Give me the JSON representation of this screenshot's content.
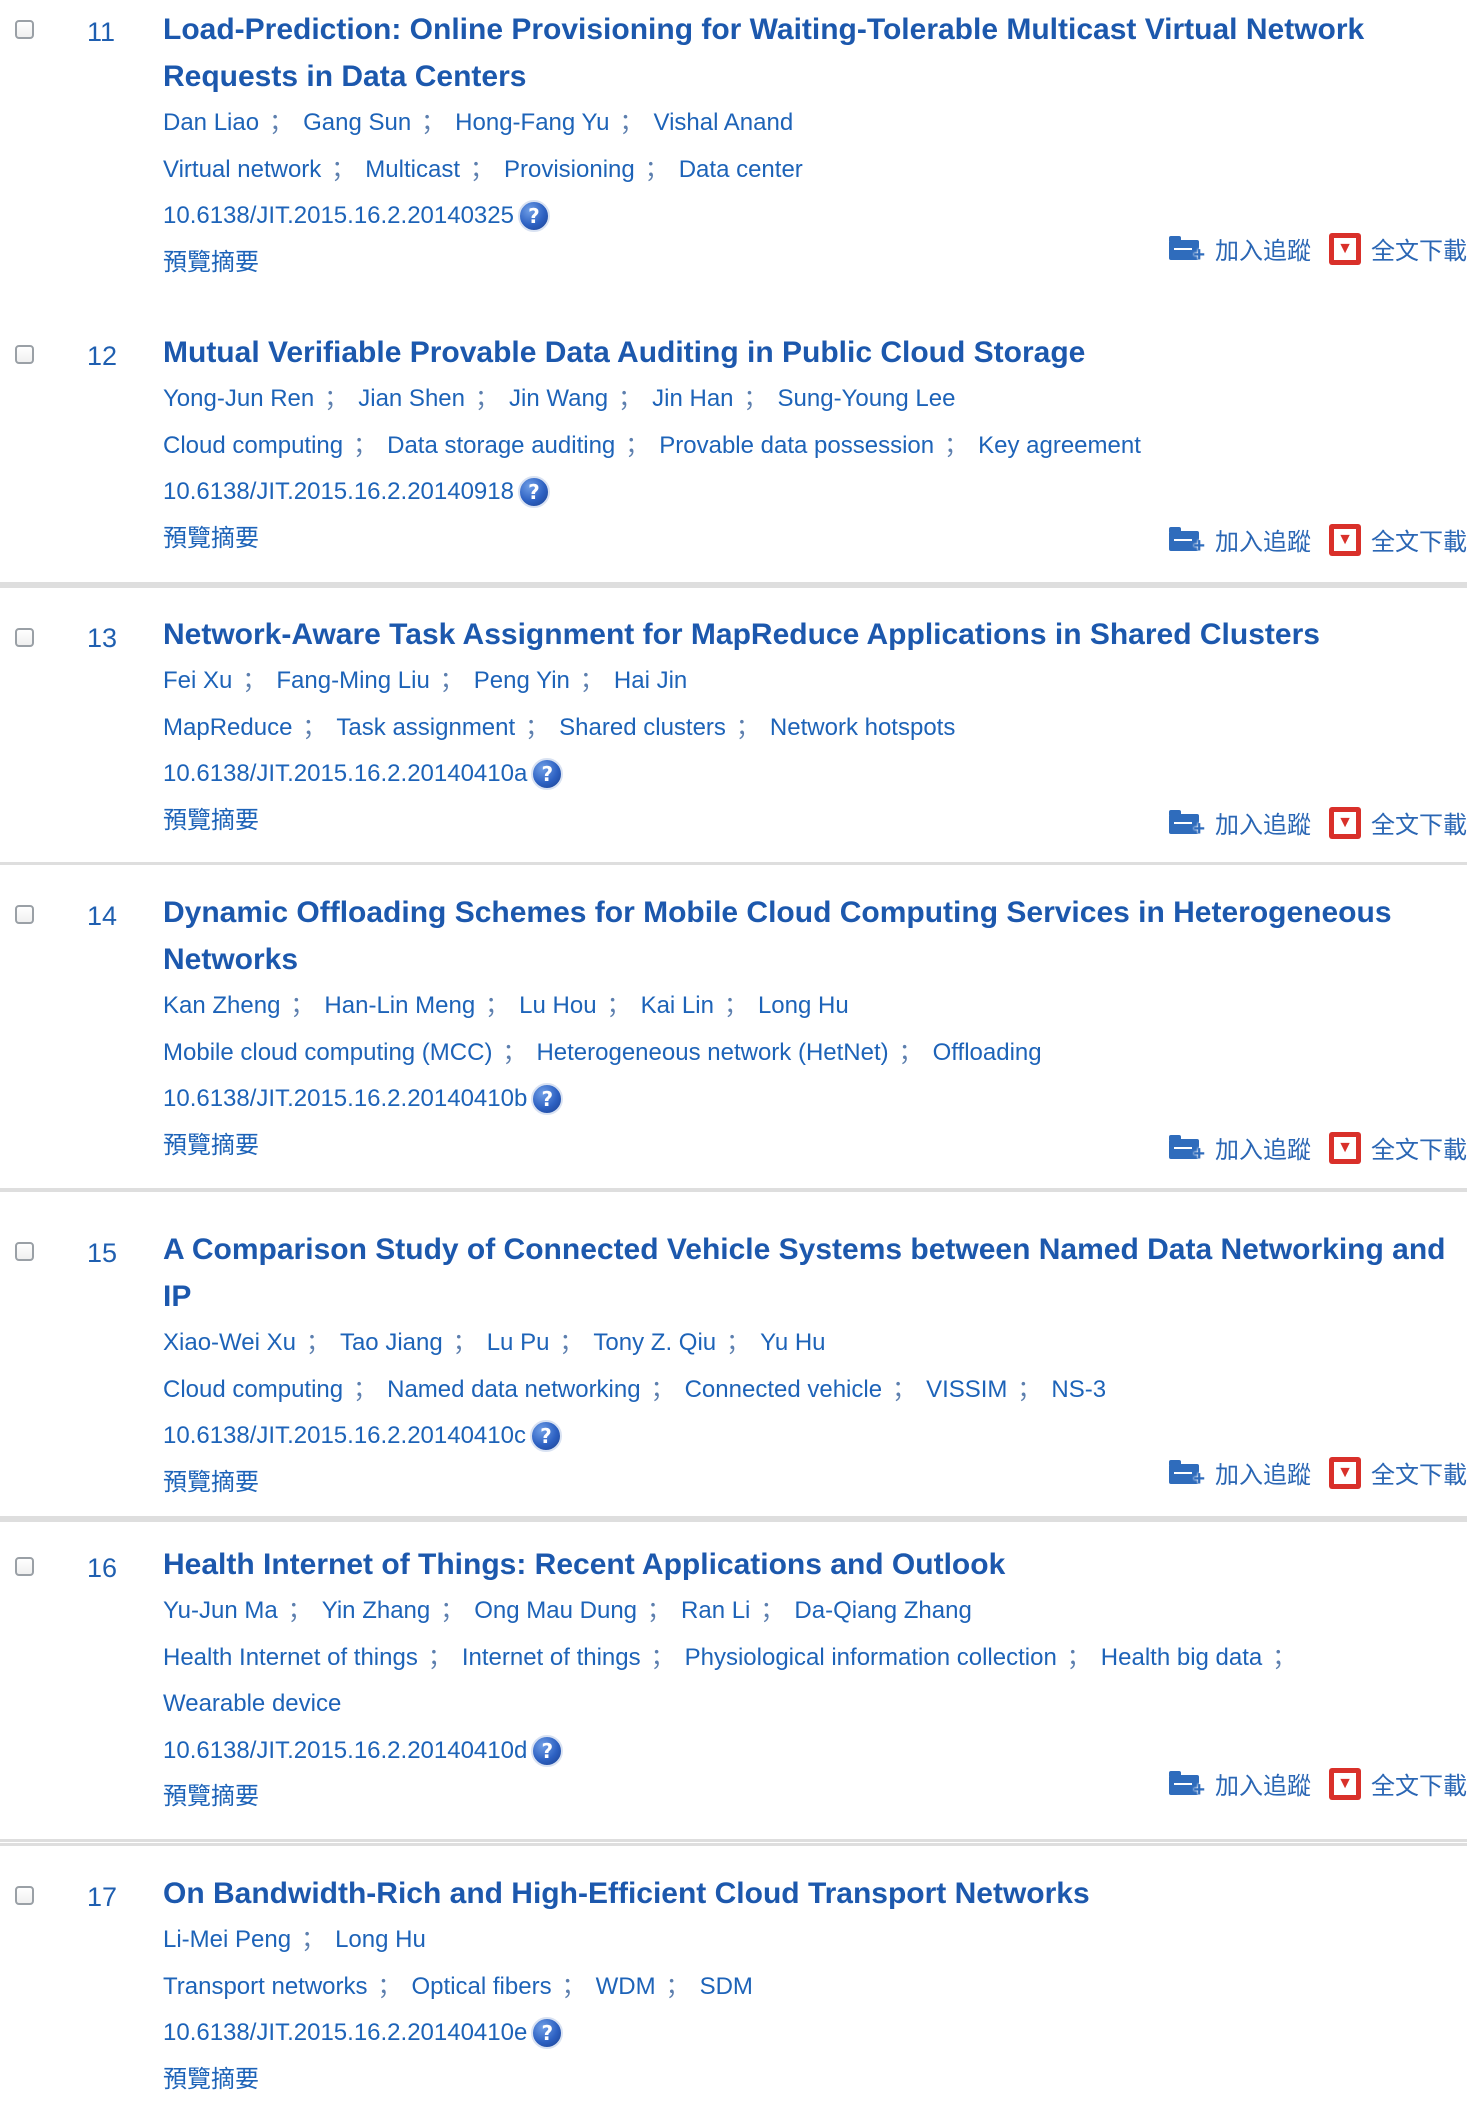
{
  "common": {
    "abstract_label": "預覽摘要",
    "track_label": "加入追蹤",
    "download_label": "全文下載",
    "help_icon": "?",
    "separator": "；"
  },
  "colors": {
    "title": "#1c58ad",
    "link": "#1d63b8",
    "divider": "#dedede",
    "download_icon": "#d9302a",
    "track_icon": "#2f6cbc"
  },
  "articles": [
    {
      "num": "11",
      "title": "Load-Prediction: Online Provisioning for Waiting-Tolerable Multicast Virtual Network Requests in Data Centers",
      "authors": [
        "Dan Liao",
        "Gang Sun",
        "Hong-Fang Yu",
        "Vishal Anand"
      ],
      "keywords": [
        "Virtual network",
        "Multicast",
        "Provisioning",
        "Data center"
      ],
      "doi": "10.6138/JIT.2015.16.2.20140325",
      "actions": true
    },
    {
      "num": "12",
      "title": "Mutual Verifiable Provable Data Auditing in Public Cloud Storage",
      "authors": [
        "Yong-Jun Ren",
        "Jian Shen",
        "Jin Wang",
        "Jin Han",
        "Sung-Young Lee"
      ],
      "keywords": [
        "Cloud computing",
        "Data storage auditing",
        "Provable data possession",
        "Key agreement"
      ],
      "doi": "10.6138/JIT.2015.16.2.20140918",
      "actions": true
    },
    {
      "num": "13",
      "title": "Network-Aware Task Assignment for MapReduce Applications in Shared Clusters",
      "authors": [
        "Fei Xu",
        "Fang-Ming Liu",
        "Peng Yin",
        "Hai Jin"
      ],
      "keywords": [
        "MapReduce",
        "Task assignment",
        "Shared clusters",
        "Network hotspots"
      ],
      "doi": "10.6138/JIT.2015.16.2.20140410a",
      "actions": true
    },
    {
      "num": "14",
      "title": "Dynamic Offloading Schemes for Mobile Cloud Computing Services in Heterogeneous Networks",
      "authors": [
        "Kan Zheng",
        "Han-Lin Meng",
        "Lu Hou",
        "Kai Lin",
        "Long Hu"
      ],
      "keywords": [
        "Mobile cloud computing (MCC)",
        "Heterogeneous network (HetNet)",
        "Offloading"
      ],
      "doi": "10.6138/JIT.2015.16.2.20140410b",
      "actions": true
    },
    {
      "num": "15",
      "title": "A Comparison Study of Connected Vehicle Systems between Named Data Networking and IP",
      "authors": [
        "Xiao-Wei Xu",
        "Tao Jiang",
        "Lu Pu",
        "Tony Z. Qiu",
        "Yu Hu"
      ],
      "keywords": [
        "Cloud computing",
        "Named data networking",
        "Connected vehicle",
        "VISSIM",
        "NS-3"
      ],
      "doi": "10.6138/JIT.2015.16.2.20140410c",
      "actions": true
    },
    {
      "num": "16",
      "title": "Health Internet of Things: Recent Applications and Outlook",
      "authors": [
        "Yu-Jun Ma",
        "Yin Zhang",
        "Ong Mau Dung",
        "Ran Li",
        "Da-Qiang Zhang"
      ],
      "keywords": [
        "Health Internet of things",
        "Internet of things",
        "Physiological information collection",
        "Health big data",
        "Wearable device"
      ],
      "doi": "10.6138/JIT.2015.16.2.20140410d",
      "actions": true
    },
    {
      "num": "17",
      "title": "On Bandwidth-Rich and High-Efficient Cloud Transport Networks",
      "authors": [
        "Li-Mei Peng",
        "Long Hu"
      ],
      "keywords": [
        "Transport networks",
        "Optical fibers",
        "WDM",
        "SDM"
      ],
      "doi": "10.6138/JIT.2015.16.2.20140410e",
      "actions": false
    }
  ]
}
